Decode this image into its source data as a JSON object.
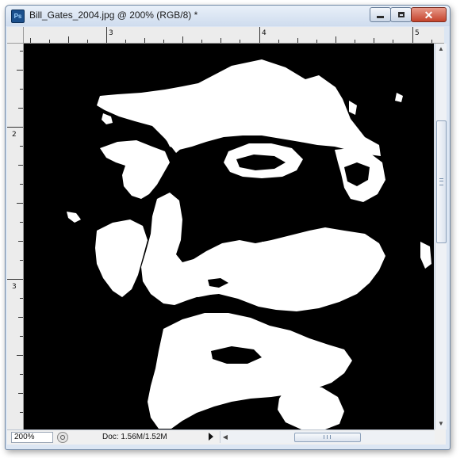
{
  "window": {
    "title": "Bill_Gates_2004.jpg @ 200% (RGB/8) *",
    "app_icon_text": "Ps",
    "close_symbol": "✕"
  },
  "rulers": {
    "top_labels": [
      "3",
      "4",
      "5"
    ],
    "left_labels": [
      "2",
      "3"
    ]
  },
  "canvas": {
    "background": "#000000",
    "foreground": "#ffffff"
  },
  "scrollbars": {
    "up_arrow": "▲",
    "down_arrow": "▼",
    "left_arrow": "◀",
    "right_arrow": "▶"
  },
  "status": {
    "zoom": "200%",
    "doc_info": "Doc: 1.56M/1.52M"
  },
  "icons": {
    "app": "photoshop-app-icon",
    "minimize": "minimize-icon",
    "maximize": "maximize-icon",
    "close": "close-icon",
    "status_toggle": "status-toggle-icon",
    "status_menu": "status-menu-arrow-icon"
  }
}
